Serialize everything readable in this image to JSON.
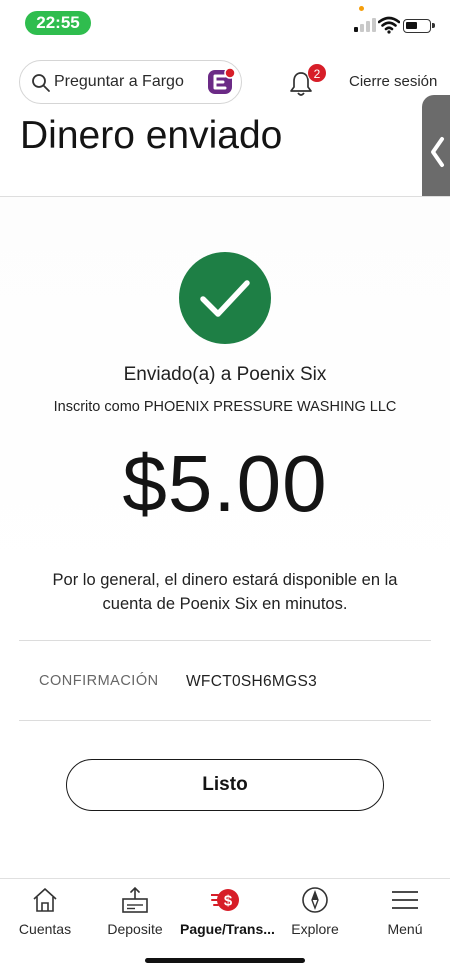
{
  "status_bar": {
    "time": "22:55"
  },
  "header": {
    "search_placeholder": "Preguntar a Fargo",
    "notification_count": "2",
    "logout_label": "Cierre sesión"
  },
  "page": {
    "title": "Dinero enviado"
  },
  "confirmation": {
    "sent_to": "Enviado(a) a Poenix Six",
    "enrolled_as": "Inscrito como PHOENIX PRESSURE WASHING LLC",
    "amount": "$5.00",
    "availability_note": "Por lo general, el dinero estará disponible en la cuenta de Poenix Six en minutos.",
    "confirmation_label": "CONFIRMACIÓN",
    "confirmation_code": "WFCT0SH6MGS3",
    "done_label": "Listo"
  },
  "bottom_nav": {
    "items": [
      {
        "label": "Cuentas",
        "icon": "home-icon"
      },
      {
        "label": "Deposite",
        "icon": "deposit-icon"
      },
      {
        "label": "Pague/Trans...",
        "icon": "pay-transfer-icon",
        "active": true
      },
      {
        "label": "Explore",
        "icon": "compass-icon"
      },
      {
        "label": "Menú",
        "icon": "hamburger-menu-icon"
      }
    ]
  },
  "colors": {
    "success_green": "#1e7f45",
    "brand_red": "#d71e28",
    "time_pill_green": "#2fbd4e",
    "fargo_purple": "#6b2a86"
  }
}
